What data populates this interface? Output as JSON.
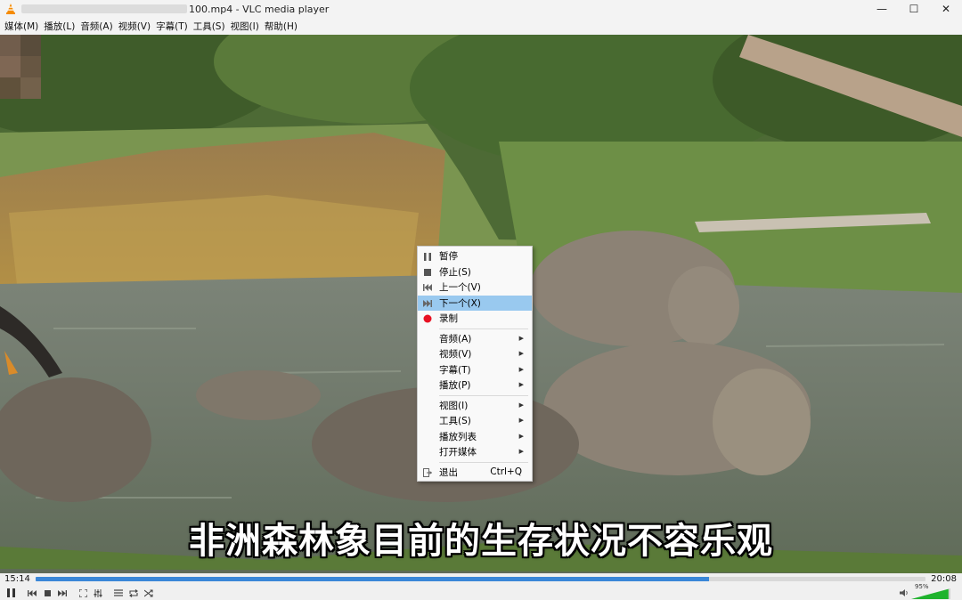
{
  "window": {
    "title": "100.mp4 - VLC media player",
    "controls": {
      "minimize": "—",
      "maximize": "☐",
      "close": "✕"
    }
  },
  "menu": [
    "媒体(M)",
    "播放(L)",
    "音频(A)",
    "视频(V)",
    "字幕(T)",
    "工具(S)",
    "视图(I)",
    "帮助(H)"
  ],
  "video": {
    "subtitle": "非洲森林象目前的生存状况不容乐观"
  },
  "context_menu": {
    "items": [
      {
        "label": "暂停",
        "icon": "pause-icon"
      },
      {
        "label": "停止(S)",
        "icon": "stop-icon"
      },
      {
        "label": "上一个(V)",
        "icon": "previous-icon"
      },
      {
        "label": "下一个(X)",
        "icon": "next-icon",
        "highlighted": true
      },
      {
        "label": "录制",
        "icon": "record-icon",
        "icon_color": "#e81123"
      },
      {
        "label": "音频(A)",
        "submenu": true
      },
      {
        "label": "视频(V)",
        "submenu": true
      },
      {
        "label": "字幕(T)",
        "submenu": true
      },
      {
        "label": "播放(P)",
        "submenu": true
      },
      {
        "label": "视图(I)",
        "submenu": true
      },
      {
        "label": "工具(S)",
        "submenu": true
      },
      {
        "label": "播放列表",
        "submenu": true
      },
      {
        "label": "打开媒体",
        "submenu": true
      },
      {
        "label": "退出",
        "icon": "exit-icon",
        "shortcut": "Ctrl+Q"
      }
    ]
  },
  "playback": {
    "elapsed": "15:14",
    "total": "20:08",
    "progress": 0.757,
    "volume_label": "95%",
    "volume_level": 0.95,
    "accent_color": "#3a87d8"
  }
}
